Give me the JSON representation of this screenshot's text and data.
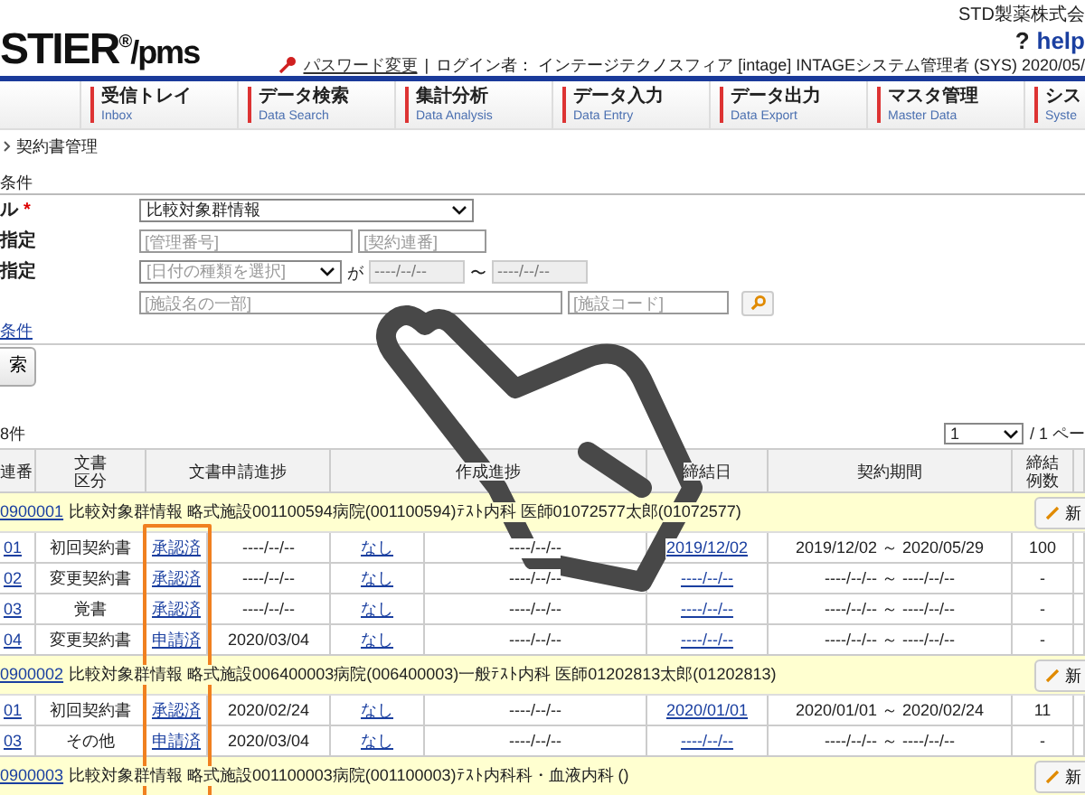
{
  "header": {
    "logo": "STIER",
    "logo_mark": "®",
    "logo_suffix": "/pms",
    "company": "STD製薬株式会",
    "help": "help",
    "help_mark": "?",
    "password_link": "パスワード変更",
    "separator": "|",
    "login": "ログイン者： インテージテクノスフィア [intage] INTAGEシステム管理者 (SYS)  2020/05/"
  },
  "nav": [
    {
      "label": "受信トレイ",
      "sub": "Inbox"
    },
    {
      "label": "データ検索",
      "sub": "Data Search"
    },
    {
      "label": "集計分析",
      "sub": "Data Analysis"
    },
    {
      "label": "データ入力",
      "sub": "Data Entry"
    },
    {
      "label": "データ出力",
      "sub": "Data Export"
    },
    {
      "label": "マスタ管理",
      "sub": "Master Data"
    },
    {
      "label": "シス",
      "sub": "Syste"
    }
  ],
  "breadcrumb": "契約書管理",
  "search": {
    "title": "条件",
    "rows": [
      {
        "label": "ル",
        "mark": "*",
        "kind": "select",
        "value": "比較対象群情報"
      },
      {
        "label": "指定",
        "kind": "pair",
        "placeholders": [
          "[管理番号]",
          "[契約連番]"
        ]
      },
      {
        "label": "指定",
        "kind": "date",
        "placeholder": "[日付の種類を選択]",
        "ga": "が",
        "from": "----/--/--",
        "tilde": "〜",
        "to": "----/--/--"
      },
      {
        "kind": "facility",
        "placeholders": [
          "[施設名の一部]",
          "[施設コード]"
        ]
      }
    ],
    "detail_link": "条件",
    "submit": "索"
  },
  "result": {
    "count": "8件",
    "page": "1",
    "page_total": "/ 1 ペー"
  },
  "table": {
    "columns": [
      {
        "label": "連番",
        "split": false
      },
      {
        "label": "文書区分",
        "split": false
      },
      {
        "label": "文書申請進捗",
        "split": true
      },
      {
        "label": "作成進捗",
        "split": true
      },
      {
        "label": "締結日",
        "split": false
      },
      {
        "label": "契約期間",
        "split": false
      },
      {
        "label": "締結例数",
        "split": false
      }
    ],
    "groups": [
      {
        "id": "0900001",
        "text": "比較対象群情報  略式施設001100594病院(001100594)ﾃｽﾄ内科  医師01072577太郎(01072577)",
        "button": "新",
        "rows": [
          {
            "no": "01",
            "type": "初回契約書",
            "apply": "承認済",
            "apply_date": "----/--/--",
            "create": "なし",
            "create_date": "----/--/--",
            "sign": "2019/12/02",
            "period": "2019/12/02 ～ 2020/05/29",
            "count": "100"
          },
          {
            "no": "02",
            "type": "変更契約書",
            "apply": "承認済",
            "apply_date": "----/--/--",
            "create": "なし",
            "create_date": "----/--/--",
            "sign": "----/--/--",
            "period": "----/--/-- ～ ----/--/--",
            "count": "-"
          },
          {
            "no": "03",
            "type": "覚書",
            "apply": "承認済",
            "apply_date": "----/--/--",
            "create": "なし",
            "create_date": "----/--/--",
            "sign": "----/--/--",
            "period": "----/--/-- ～ ----/--/--",
            "count": "-"
          },
          {
            "no": "04",
            "type": "変更契約書",
            "apply": "申請済",
            "apply_date": "2020/03/04",
            "create": "なし",
            "create_date": "----/--/--",
            "sign": "----/--/--",
            "period": "----/--/-- ～ ----/--/--",
            "count": "-"
          }
        ]
      },
      {
        "id": "0900002",
        "text": "比較対象群情報  略式施設006400003病院(006400003)一般ﾃｽﾄ内科  医師01202813太郎(01202813)",
        "button": "新",
        "rows": [
          {
            "no": "01",
            "type": "初回契約書",
            "apply": "承認済",
            "apply_date": "2020/02/24",
            "create": "なし",
            "create_date": "----/--/--",
            "sign": "2020/01/01",
            "period": "2020/01/01 ～ 2020/02/24",
            "count": "11"
          },
          {
            "no": "03",
            "type": "その他",
            "apply": "申請済",
            "apply_date": "2020/03/04",
            "create": "なし",
            "create_date": "----/--/--",
            "sign": "----/--/--",
            "period": "----/--/-- ～ ----/--/--",
            "count": "-"
          }
        ]
      },
      {
        "id": "0900003",
        "text": "比較対象群情報  略式施設001100003病院(001100003)ﾃｽﾄ内科科・血液内科  ()",
        "button": "新"
      }
    ]
  }
}
